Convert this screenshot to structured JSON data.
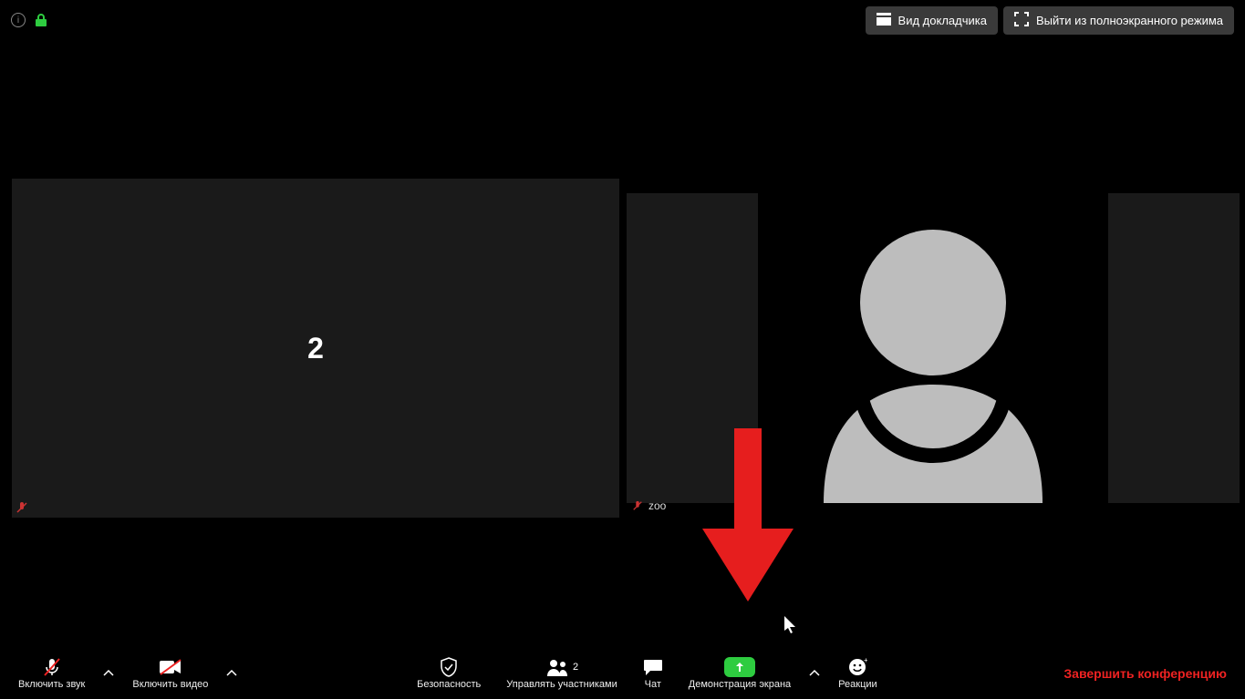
{
  "top": {
    "speaker_view": "Вид докладчика",
    "exit_fullscreen": "Выйти из полноэкранного режима"
  },
  "tiles": {
    "left_center_text": "2",
    "right_label": "zoo"
  },
  "toolbar": {
    "audio": "Включить звук",
    "video": "Включить видео",
    "security": "Безопасность",
    "participants": "Управлять участниками",
    "participants_count": "2",
    "chat": "Чат",
    "share": "Демонстрация экрана",
    "reactions": "Реакции",
    "end": "Завершить конференцию"
  }
}
